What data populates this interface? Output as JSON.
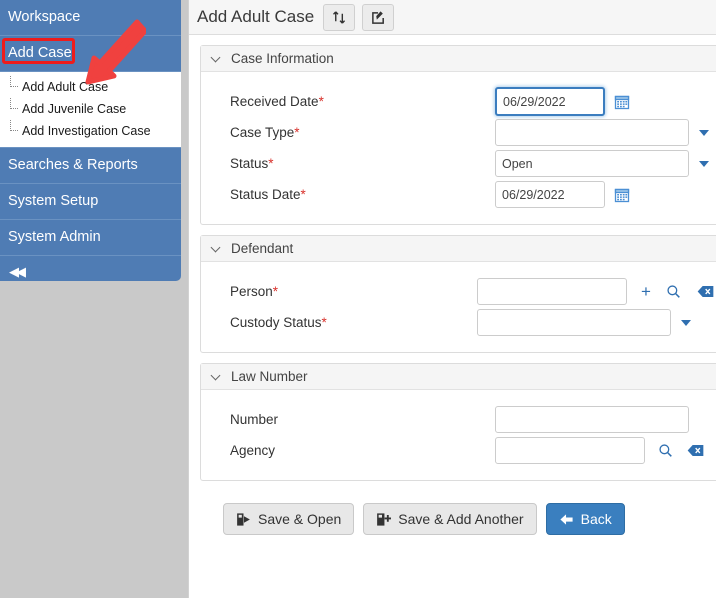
{
  "sidebar": {
    "groups": [
      {
        "label": "Workspace",
        "name": "workspace"
      },
      {
        "label": "Add Case",
        "name": "add-case"
      },
      {
        "label": "Searches & Reports",
        "name": "searches-reports"
      },
      {
        "label": "System Setup",
        "name": "system-setup"
      },
      {
        "label": "System Admin",
        "name": "system-admin"
      }
    ],
    "submenu": [
      {
        "label": "Add Adult Case",
        "name": "add-adult-case"
      },
      {
        "label": "Add Juvenile Case",
        "name": "add-juvenile-case"
      },
      {
        "label": "Add Investigation Case",
        "name": "add-investigation-case"
      }
    ],
    "collapse_icon": "collapse-left-icon",
    "collapse_glyph": "◀◀",
    "background_color": "#4f7cb4",
    "submenu_background": "#ffffff"
  },
  "annotation": {
    "highlight_target": "Add Case",
    "arrow_target": "Add Adult Case",
    "color": "#ee1c1c"
  },
  "header": {
    "title": "Add Adult Case",
    "buttons": [
      {
        "name": "swap-refresh-icon",
        "title": "Swap"
      },
      {
        "name": "edit-square-icon",
        "title": "Edit"
      }
    ]
  },
  "sections": [
    {
      "name": "case-information",
      "title": "Case Information",
      "collapsed": false,
      "fields": [
        {
          "name": "received-date",
          "label": "Received Date",
          "required": true,
          "control": "date",
          "value": "06/29/2022",
          "placeholder": "",
          "focused": true,
          "icon": "calendar-icon"
        },
        {
          "name": "case-type",
          "label": "Case Type",
          "required": true,
          "control": "dropdown",
          "value": "",
          "placeholder": "",
          "focused": false,
          "icon": "chevron-down-icon"
        },
        {
          "name": "status",
          "label": "Status",
          "required": true,
          "control": "dropdown",
          "value": "Open",
          "placeholder": "",
          "focused": false,
          "icon": "chevron-down-icon"
        },
        {
          "name": "status-date",
          "label": "Status Date",
          "required": true,
          "control": "date",
          "value": "06/29/2022",
          "placeholder": "",
          "focused": false,
          "icon": "calendar-icon"
        }
      ]
    },
    {
      "name": "defendant",
      "title": "Defendant",
      "collapsed": false,
      "fields": [
        {
          "name": "person",
          "label": "Person",
          "required": true,
          "control": "lookup",
          "value": "",
          "placeholder": "",
          "focused": false,
          "icons": [
            "plus-icon",
            "search-icon",
            "clear-backspace-icon"
          ]
        },
        {
          "name": "custody-status",
          "label": "Custody Status",
          "required": true,
          "control": "dropdown",
          "value": "",
          "placeholder": "",
          "focused": false,
          "icon": "chevron-down-icon"
        }
      ]
    },
    {
      "name": "law-number",
      "title": "Law Number",
      "collapsed": false,
      "fields": [
        {
          "name": "number",
          "label": "Number",
          "required": false,
          "control": "text",
          "value": "",
          "placeholder": "",
          "focused": false,
          "icons": []
        },
        {
          "name": "agency",
          "label": "Agency",
          "required": false,
          "control": "lookup",
          "value": "",
          "placeholder": "",
          "focused": false,
          "icons": [
            "search-icon",
            "clear-backspace-icon"
          ]
        }
      ]
    }
  ],
  "footer": {
    "buttons": [
      {
        "name": "save-and-open",
        "label": "Save & Open",
        "icon": "save-open-icon",
        "style": "grey"
      },
      {
        "name": "save-and-add-another",
        "label": "Save & Add Another",
        "icon": "save-add-icon",
        "style": "grey"
      },
      {
        "name": "back",
        "label": "Back",
        "icon": "arrow-left-icon",
        "style": "blue"
      }
    ],
    "accent_color": "#3a7fbf"
  }
}
